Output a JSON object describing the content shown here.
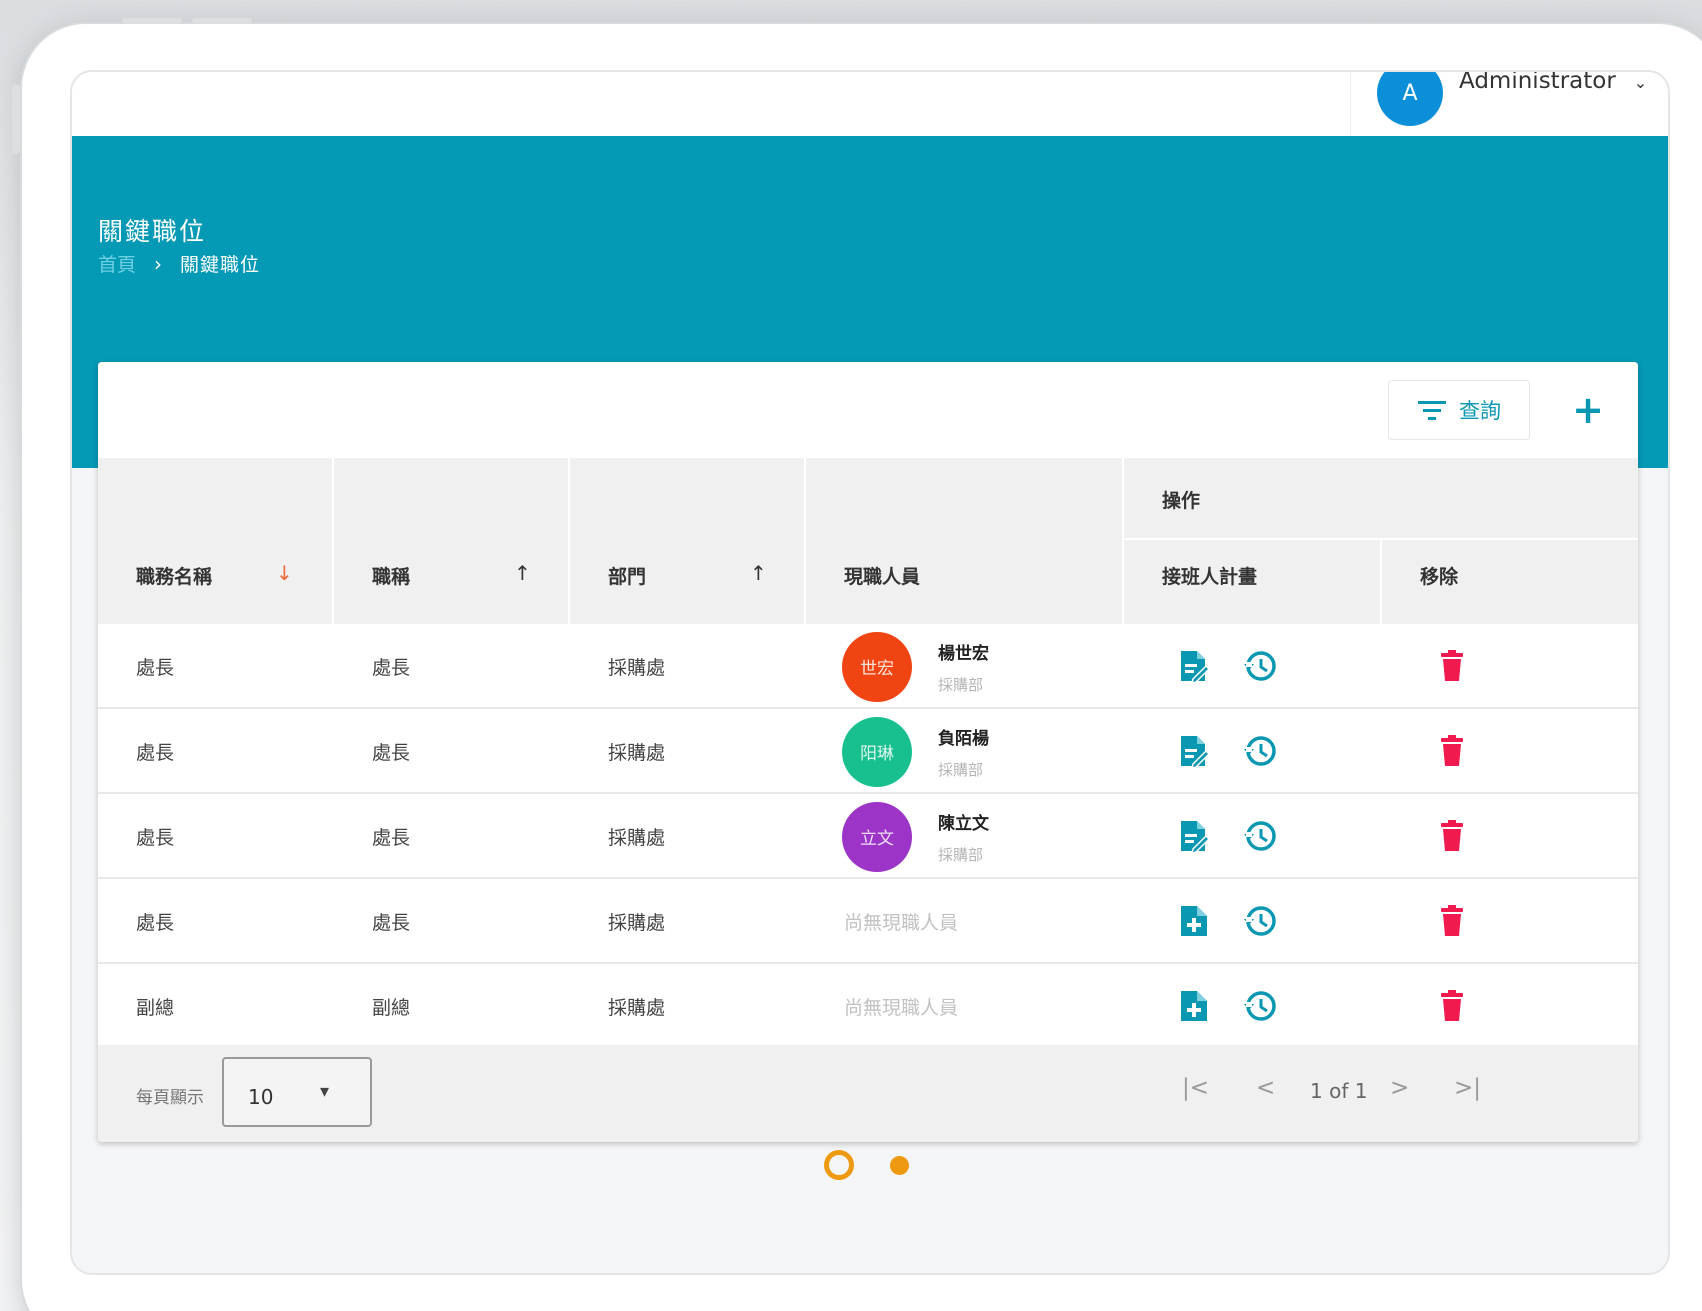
{
  "header": {
    "user_initial": "A",
    "user_name": "Administrator",
    "user_avatar_color": "#0b8fd9"
  },
  "banner": {
    "title": "關鍵職位",
    "breadcrumb": {
      "home": "首頁",
      "current": "關鍵職位"
    },
    "color": "#0499b5"
  },
  "toolbar": {
    "query_label": "查詢",
    "add_icon": "plus-icon"
  },
  "table": {
    "group_header": "操作",
    "columns": {
      "job_name": "職務名稱",
      "title": "職稱",
      "department": "部門",
      "incumbent": "現職人員",
      "successor_plan": "接班人計畫",
      "remove": "移除"
    },
    "rows": [
      {
        "job_name": "處長",
        "title": "處長",
        "department": "採購處",
        "incumbent": {
          "initials": "世宏",
          "name": "楊世宏",
          "dept": "採購部",
          "color": "#f04412"
        },
        "plan_icon": "document-edit-icon"
      },
      {
        "job_name": "處長",
        "title": "處長",
        "department": "採購處",
        "incumbent": {
          "initials": "阳琳",
          "name": "負陌楊",
          "dept": "採購部",
          "color": "#18c08f"
        },
        "plan_icon": "document-edit-icon"
      },
      {
        "job_name": "處長",
        "title": "處長",
        "department": "採購處",
        "incumbent": {
          "initials": "立文",
          "name": "陳立文",
          "dept": "採購部",
          "color": "#9c34c8"
        },
        "plan_icon": "document-edit-icon"
      },
      {
        "job_name": "處長",
        "title": "處長",
        "department": "採購處",
        "no_incumbent": "尚無現職人員",
        "plan_icon": "document-add-icon"
      },
      {
        "job_name": "副總",
        "title": "副總",
        "department": "採購處",
        "no_incumbent": "尚無現職人員",
        "plan_icon": "document-add-icon"
      }
    ]
  },
  "footer": {
    "per_page_label": "每頁顯示",
    "per_page_value": "10",
    "page_info": "1 of 1"
  },
  "colors": {
    "accent": "#0a97b2",
    "delete": "#f01a4f",
    "carousel": "#ee9a10"
  }
}
